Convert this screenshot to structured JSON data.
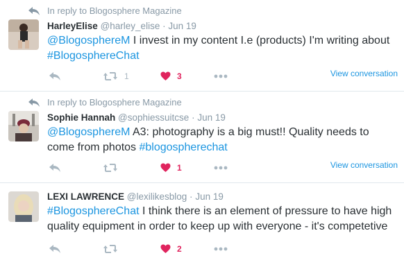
{
  "tweets": [
    {
      "context": "In reply to Blogosphere Magazine",
      "fullname": "HarleyElise",
      "screen_name": "@harley_elise",
      "date": "Jun 19",
      "mention": "@BlogosphereM",
      "text_mid": " I invest in my content I.e (products) I'm writing about ",
      "hashtag": "#BlogosphereChat",
      "text_end": "",
      "retweet_count": "1",
      "like_count": "3",
      "view_conversation": "View conversation"
    },
    {
      "context": "In reply to Blogosphere Magazine",
      "fullname": "Sophie Hannah",
      "screen_name": "@sophiessuitcse",
      "date": "Jun 19",
      "mention": "@BlogosphereM",
      "text_mid": " A3: photography is a big must!! Quality needs to come from photos ",
      "hashtag": "#blogospherechat",
      "text_end": "",
      "retweet_count": "",
      "like_count": "1",
      "view_conversation": "View conversation"
    },
    {
      "fullname": "LEXI LAWRENCE",
      "screen_name": "@lexilikesblog",
      "date": "Jun 19",
      "hashtag": "#BlogosphereChat",
      "text_mid": " I think there is an element of pressure to have high quality equipment in order to keep up with everyone - it's competetive",
      "retweet_count": "",
      "like_count": "2"
    }
  ],
  "separator": "·",
  "colors": {
    "link": "#1b95e0",
    "muted": "#8899a6",
    "like": "#e0245e",
    "border": "#e1e8ed"
  },
  "icons": [
    "reply-icon",
    "retweet-icon",
    "heart-icon",
    "more-icon"
  ]
}
